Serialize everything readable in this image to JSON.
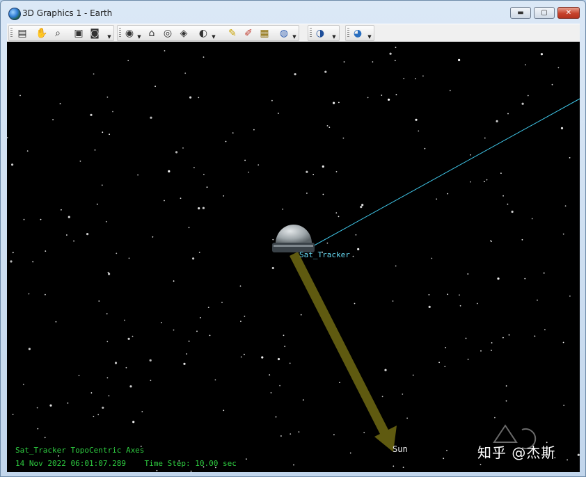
{
  "window": {
    "title": "3D Graphics 1 - Earth",
    "minimize_label": "▬",
    "maximize_label": "▢",
    "close_label": "✕"
  },
  "toolbar": {
    "buttons": [
      {
        "name": "properties-icon",
        "glyph": "▤"
      },
      {
        "name": "pan-hand-icon",
        "glyph": "✋"
      },
      {
        "name": "zoom-icon",
        "glyph": "⌕"
      },
      {
        "name": "snapshot-icon",
        "glyph": "▣"
      },
      {
        "name": "record-icon",
        "glyph": "◙"
      },
      {
        "name": "view-from-icon",
        "glyph": "◉"
      },
      {
        "name": "home-view-icon",
        "glyph": "⌂"
      },
      {
        "name": "view-to-icon",
        "glyph": "◎"
      },
      {
        "name": "orient-view-icon",
        "glyph": "◈"
      },
      {
        "name": "view-options-icon",
        "glyph": "◐"
      },
      {
        "name": "pencil-icon",
        "glyph": "✎"
      },
      {
        "name": "eraser-icon",
        "glyph": "✐"
      },
      {
        "name": "measure-icon",
        "glyph": "▦"
      },
      {
        "name": "globe-settings-icon",
        "glyph": "◍"
      },
      {
        "name": "map-layers-icon",
        "glyph": "◑"
      },
      {
        "name": "earth-icon",
        "glyph": "◕"
      }
    ]
  },
  "scene": {
    "object_label": "Sat_Tracker",
    "sun_label": "Sun",
    "axes_text": "Sat_Tracker TopoCentric Axes",
    "datetime": "14 Nov 2022 06:01:07.289",
    "time_step": "Time Step: 10.00 sec",
    "watermark": "知乎 @杰斯",
    "colors": {
      "background": "#000000",
      "object_label": "#66d9f2",
      "status_text": "#2ecc40",
      "sun_vector": "#5f5a10",
      "line_of_sight": "#3fc6e8"
    }
  }
}
